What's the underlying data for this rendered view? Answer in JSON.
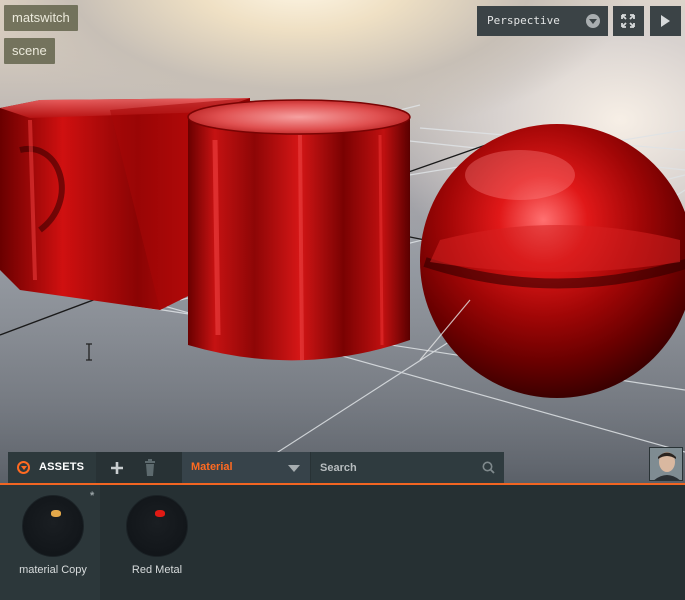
{
  "project": {
    "name": "matswitch",
    "scene": "scene"
  },
  "viewport": {
    "camera_mode": "Perspective",
    "fullscreen_icon": "fullscreen-icon",
    "play_icon": "play-icon"
  },
  "assets": {
    "tab_label": "ASSETS",
    "type_filter": "Material",
    "search_placeholder": "Search",
    "accent_color": "#f26522",
    "items": [
      {
        "name": "material Copy",
        "modified_marker": "*",
        "highlight_color": "#e3a84a"
      },
      {
        "name": "Red Metal",
        "modified_marker": "",
        "highlight_color": "#e01a14"
      }
    ]
  }
}
